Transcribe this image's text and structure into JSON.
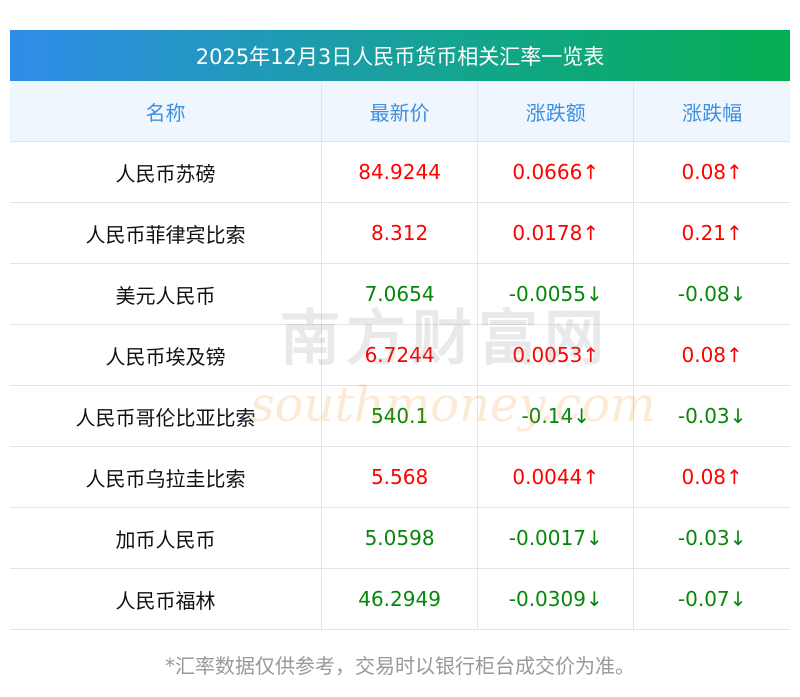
{
  "title": "2025年12月3日人民币货币相关汇率一览表",
  "headers": [
    "名称",
    "最新价",
    "涨跌额",
    "涨跌幅"
  ],
  "rows": [
    {
      "name": "人民币苏磅",
      "price": "84.9244",
      "change": "0.0666↑",
      "pct": "0.08↑",
      "dir": "up"
    },
    {
      "name": "人民币菲律宾比索",
      "price": "8.312",
      "change": "0.0178↑",
      "pct": "0.21↑",
      "dir": "up"
    },
    {
      "name": "美元人民币",
      "price": "7.0654",
      "change": "-0.0055↓",
      "pct": "-0.08↓",
      "dir": "down"
    },
    {
      "name": "人民币埃及镑",
      "price": "6.7244",
      "change": "0.0053↑",
      "pct": "0.08↑",
      "dir": "up"
    },
    {
      "name": "人民币哥伦比亚比索",
      "price": "540.1",
      "change": "-0.14↓",
      "pct": "-0.03↓",
      "dir": "down"
    },
    {
      "name": "人民币乌拉圭比索",
      "price": "5.568",
      "change": "0.0044↑",
      "pct": "0.08↑",
      "dir": "up"
    },
    {
      "name": "加币人民币",
      "price": "5.0598",
      "change": "-0.0017↓",
      "pct": "-0.03↓",
      "dir": "down"
    },
    {
      "name": "人民币福林",
      "price": "46.2949",
      "change": "-0.0309↓",
      "pct": "-0.07↓",
      "dir": "down"
    }
  ],
  "watermark": {
    "cn": "南方财富网",
    "en": "southmoney.com"
  },
  "footer": "*汇率数据仅供参考，交易时以银行柜台成交价为准。",
  "colors": {
    "up": "#ff0000",
    "down": "#06870a",
    "header_text": "#3d8fe0"
  }
}
